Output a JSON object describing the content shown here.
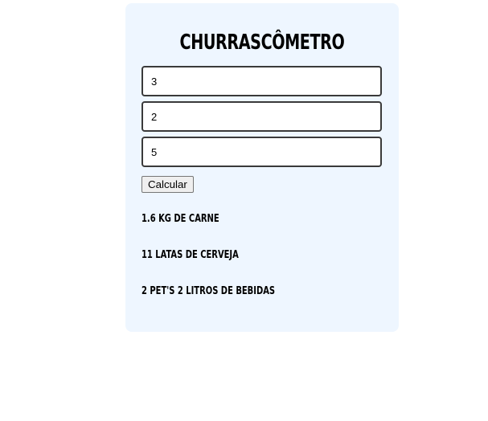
{
  "app": {
    "title": "CHURRASCÔMETRO"
  },
  "form": {
    "inputs": [
      {
        "value": "3"
      },
      {
        "value": "2"
      },
      {
        "value": "5"
      }
    ],
    "calculate_label": "Calcular"
  },
  "results": {
    "carne": "1.6 KG DE CARNE",
    "cerveja": "11 LATAS DE CERVEJA",
    "bebidas": "2 PET'S 2 LITROS DE BEBIDAS"
  },
  "colors": {
    "card_background": "#eef6ff",
    "page_background": "#ffffff",
    "input_border": "#3a3a3a",
    "text": "#000000"
  }
}
